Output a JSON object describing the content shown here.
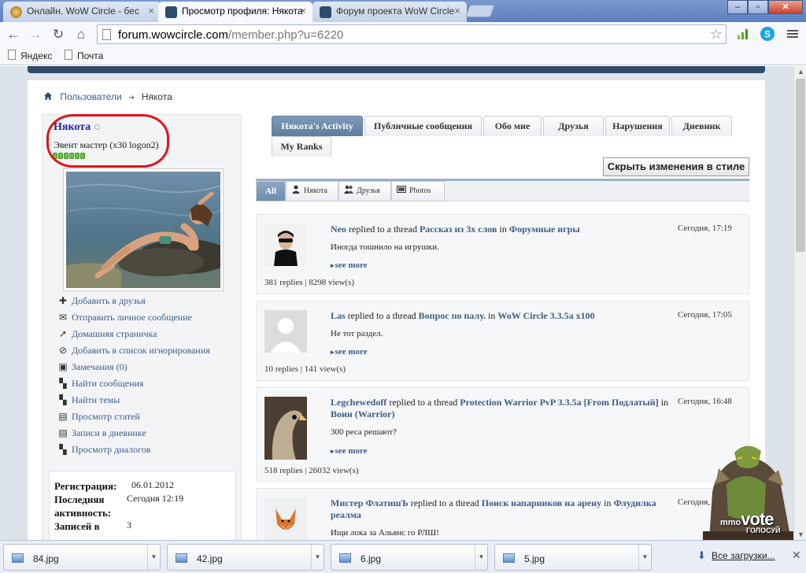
{
  "browser": {
    "tabs": [
      {
        "label": "Онлайн. WoW Circle - бес",
        "active": false
      },
      {
        "label": "Просмотр профиля: Някота",
        "active": true
      },
      {
        "label": "Форум проекта WoW Circle",
        "active": false
      }
    ],
    "url_domain": "forum.wowcircle.com",
    "url_path": "/member.php?u=6220",
    "bookmarks": [
      "Яндекс",
      "Почта"
    ]
  },
  "breadcrumb": {
    "parent": "Пользователи",
    "current": "Някота"
  },
  "profile": {
    "username": "Някота",
    "title": "Эвент мастер (x30 logon2)",
    "reputation_pips": 6,
    "actions": [
      {
        "icon": "plus-icon",
        "label": "Добавить в друзья"
      },
      {
        "icon": "envelope-icon",
        "label": "Отправить личное сообщение"
      },
      {
        "icon": "cursor-icon",
        "label": "Домашняя страничка"
      },
      {
        "icon": "block-icon",
        "label": "Добавить в список игнорирования"
      },
      {
        "icon": "infraction-icon",
        "label": "Замечания (0)"
      },
      {
        "icon": "posts-icon",
        "label": "Найти сообщения"
      },
      {
        "icon": "threads-icon",
        "label": "Найти темы"
      },
      {
        "icon": "articles-icon",
        "label": "Просмотр статей"
      },
      {
        "icon": "diary-icon",
        "label": "Записи в дневнике"
      },
      {
        "icon": "dialogs-icon",
        "label": "Просмотр диалогов"
      }
    ],
    "stats": {
      "reg_label": "Регистрация:",
      "reg_value": "06.01.2012",
      "last_label_1": "Последняя",
      "last_label_2": "активность:",
      "last_value": "Сегодня 12:19",
      "posts_label_1": "Записей в",
      "posts_value": "3"
    }
  },
  "profile_tabs": [
    "Някота's Activity",
    "Публичные сообщения",
    "Обо мне",
    "Друзья",
    "Нарушения",
    "Дневник",
    "My Ranks"
  ],
  "hide_style_button": "Скрыть изменения в стиле",
  "filters": [
    "All",
    "Някота",
    "Друзья",
    "Photos"
  ],
  "feed": [
    {
      "user": "Neo",
      "action": "replied to a thread",
      "thread": "Рассказ из 3х слов",
      "in": "in",
      "forum": "Форумные игры",
      "time": "Сегодня, 17:19",
      "message": "Иногда тошнило на игрушки.",
      "see_more": "see more",
      "stats": "381 replies | 8298 view(s)"
    },
    {
      "user": "Las",
      "action": "replied to a thread",
      "thread": "Вопрос по палу.",
      "in": "in",
      "forum": "WoW Circle 3.3.5a x100",
      "time": "Сегодня, 17:05",
      "message": "Не тот раздел.",
      "see_more": "see more",
      "stats": "10 replies | 141 view(s)"
    },
    {
      "user": "Legchewedoff",
      "action": "replied to a thread",
      "thread": "Protection Warrior PvP 3.3.5a [From Подлатый]",
      "in": "in",
      "forum": "Воин (Warrior)",
      "time": "Сегодня, 16:48",
      "message": "300 реса решают?",
      "see_more": "see more",
      "stats": "518 replies | 26032 view(s)"
    },
    {
      "user": "Мистер ФлатишЪ",
      "action": "replied to a thread",
      "thread": "Поиск напарников на арену",
      "in": "in",
      "forum": "Флудилка реалма",
      "time": "Сегодня,",
      "message": "Ищи лока за Альянс го РЛШ!",
      "see_more": "",
      "stats": ""
    }
  ],
  "vote_ad": {
    "brand_a": "mmo",
    "brand_b": "vote",
    "label": "ГОЛОСУЙ"
  },
  "downloads": {
    "items": [
      "84.jpg",
      "42.jpg",
      "6.jpg",
      "5.jpg"
    ],
    "all_label": "Все загрузки..."
  }
}
